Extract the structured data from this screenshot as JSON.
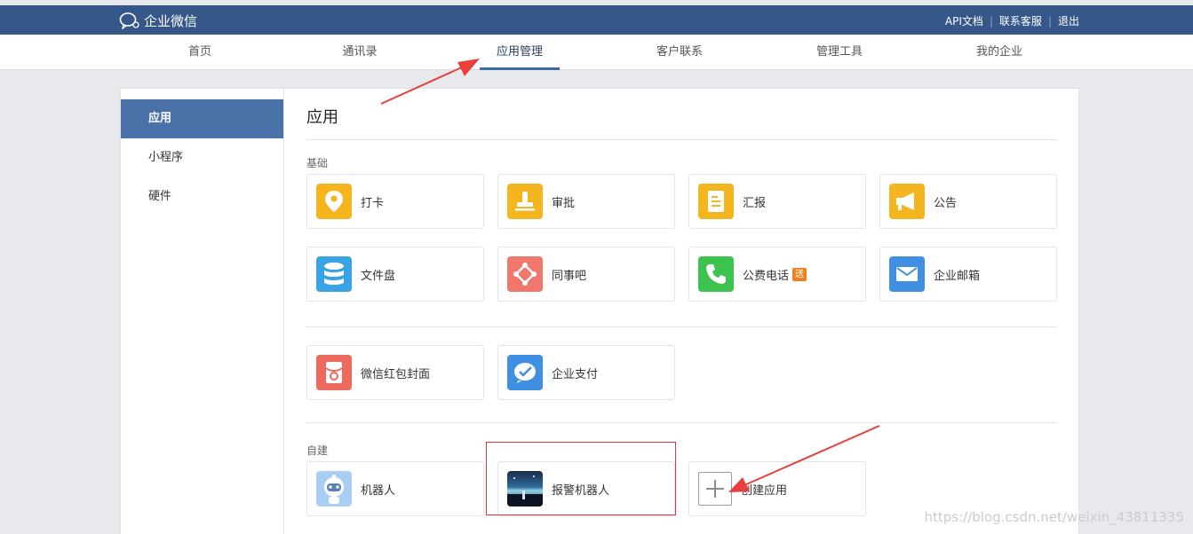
{
  "topbar": {
    "brand": "企业微信",
    "links": [
      "API文档",
      "联系客服",
      "退出"
    ]
  },
  "nav": {
    "tabs": [
      "首页",
      "通讯录",
      "应用管理",
      "客户联系",
      "管理工具",
      "我的企业"
    ],
    "active": "应用管理"
  },
  "sidebar": {
    "items": [
      "应用",
      "小程序",
      "硬件"
    ],
    "active": "应用"
  },
  "main": {
    "title": "应用",
    "basic_label": "基础",
    "basic_apps": [
      "打卡",
      "审批",
      "汇报",
      "公告",
      "文件盘",
      "同事吧",
      "公费电话",
      "企业邮箱"
    ],
    "phone_badge": "送",
    "extra_apps": [
      "微信红包封面",
      "企业支付"
    ],
    "custom_label": "自建",
    "custom_apps": [
      "机器人",
      "报警机器人"
    ],
    "create_label": "创建应用"
  },
  "watermark": "https://blog.csdn.net/weixin_43811335",
  "colors": {
    "topbar": "#35578a",
    "sidebar_active": "#4a72a8",
    "yellow_icon": "#f4b51e",
    "red_highlight": "#e0353b",
    "arrow": "#e8403c"
  }
}
